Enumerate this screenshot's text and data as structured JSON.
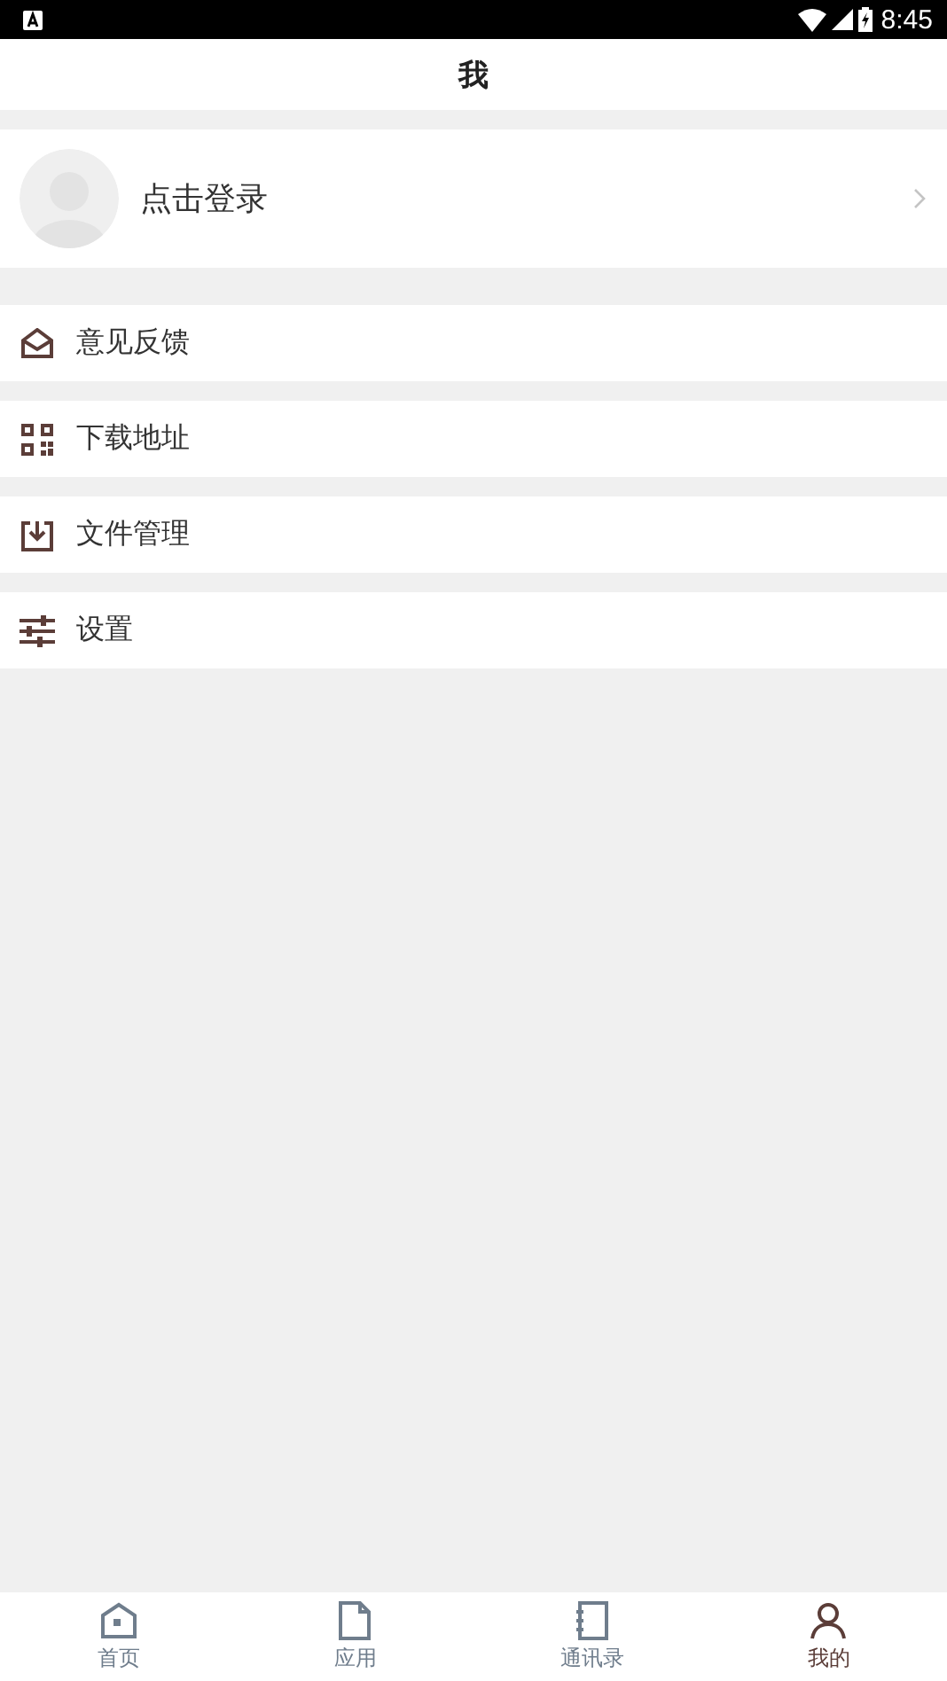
{
  "status_bar": {
    "time": "8:45"
  },
  "header": {
    "title": "我"
  },
  "profile": {
    "label": "点击登录"
  },
  "menu": [
    {
      "kind": "feedback",
      "label": "意见反馈"
    },
    {
      "kind": "qrcode",
      "label": "下载地址"
    },
    {
      "kind": "download",
      "label": "文件管理"
    },
    {
      "kind": "settings",
      "label": "设置"
    }
  ],
  "nav": [
    {
      "kind": "home",
      "label": "首页",
      "selected": false
    },
    {
      "kind": "apps",
      "label": "应用",
      "selected": false
    },
    {
      "kind": "contacts",
      "label": "通讯录",
      "selected": false
    },
    {
      "kind": "me",
      "label": "我的",
      "selected": true
    }
  ]
}
